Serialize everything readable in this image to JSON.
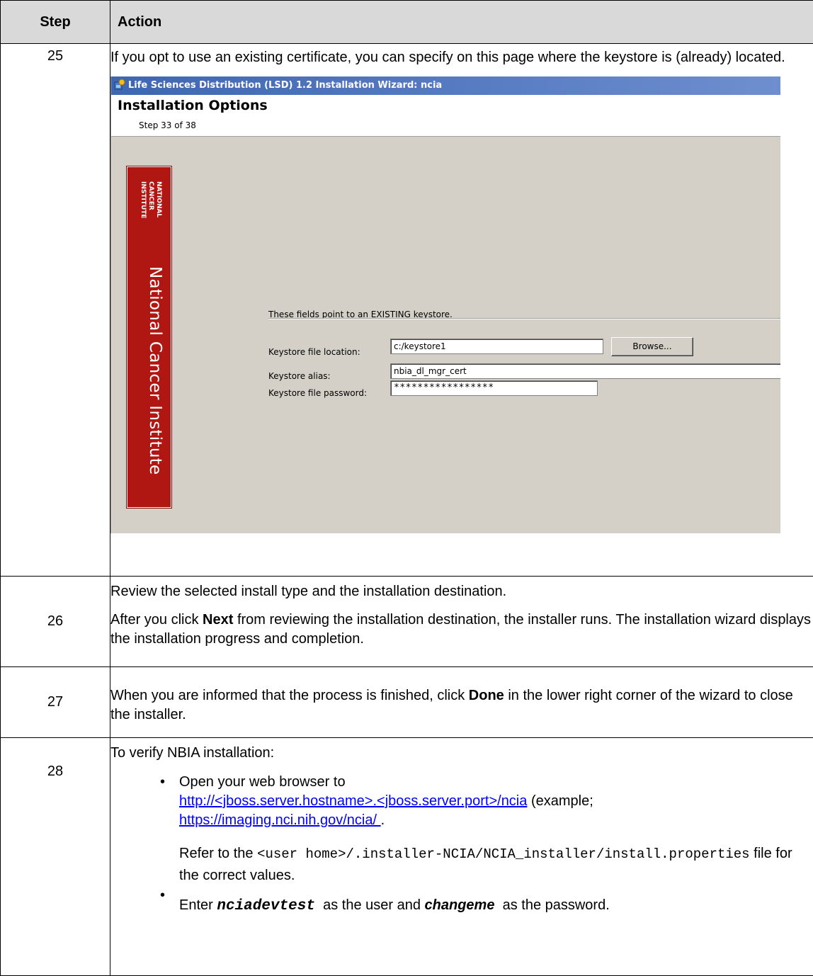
{
  "table": {
    "header_step": "Step",
    "header_action": "Action"
  },
  "rows": {
    "r25": {
      "num": "25",
      "text": "If you opt to use an existing certificate, you can specify on this page where the keystore is (already) located."
    },
    "r26": {
      "num": "26",
      "text1": "Review the selected install type and the installation destination.",
      "text2_a": "After you click ",
      "text2_b": "Next",
      "text2_c": " from reviewing the installation destination, the installer runs. The installation wizard displays the installation progress and completion."
    },
    "r27": {
      "num": "27",
      "text_a": "When you are informed that the process is finished, click ",
      "text_b": "Done",
      "text_c": " in the lower right corner of the wizard to close the installer."
    },
    "r28": {
      "num": "28",
      "intro": "To verify NBIA installation:",
      "b1_a": "Open your web browser to ",
      "b1_link1": "http://<jboss.server.hostname>.<jboss.server.port>/ncia",
      "b1_b": " (example; ",
      "b1_link2": "https://imaging.nci.nih.gov/ncia/ ",
      "b1_c": ".",
      "b1_refer_a": "Refer to the ",
      "b1_refer_code": "<user home>/.installer-NCIA/NCIA_installer/install.properties",
      "b1_refer_b": " file for the correct values.",
      "b2_a": "Enter ",
      "b2_user": "nciadevtest",
      "b2_b": "  as the user and ",
      "b2_pass": "changeme",
      "b2_c": "  as the password."
    }
  },
  "wizard": {
    "title": "Life Sciences Distribution (LSD) 1.2 Installation Wizard: ncia",
    "heading": "Installation Options",
    "step": "Step 33 of 38",
    "banner_logo": "NATIONAL CANCER INSTITUTE",
    "banner_text": "National Cancer Institute",
    "banner_color": "#b01612",
    "intro": "These fields point to an EXISTING keystore.",
    "location_label": "Keystore file location:",
    "location_value": "c:/keystore1",
    "browse_label": "Browse...",
    "alias_label": "Keystore alias:",
    "alias_value": "nbia_dl_mgr_cert",
    "password_label": "Keystore file password:",
    "password_value": "*****************"
  }
}
